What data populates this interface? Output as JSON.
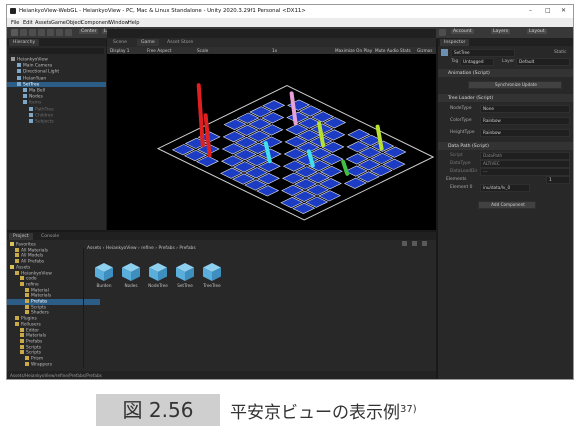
{
  "window": {
    "title": "HeiankyoView-WebGL - HeiankyoView - PC, Mac & Linux Standalone - Unity 2020.3.29f1 Personal <DX11>",
    "menu": [
      "File",
      "Edit",
      "Assets",
      "GameObject",
      "Component",
      "Window",
      "Help"
    ]
  },
  "toolbar": {
    "center_label": "Center",
    "local_label": "Local",
    "account_label": "Account",
    "layers_label": "Layers",
    "layout_label": "Layout"
  },
  "hierarchy": {
    "tab": "Hierarchy",
    "items": [
      {
        "label": "HeiankyoView",
        "depth": 0
      },
      {
        "label": "Main Camera",
        "depth": 1
      },
      {
        "label": "Directional Light",
        "depth": 1
      },
      {
        "label": "HeianYuan",
        "depth": 1
      },
      {
        "label": "SetTree",
        "depth": 1,
        "selected": true
      },
      {
        "label": "Ma Bell",
        "depth": 2
      },
      {
        "label": "Nodes",
        "depth": 2
      },
      {
        "label": "Items",
        "depth": 2,
        "faded": true
      },
      {
        "label": "PathTree",
        "depth": 3,
        "faded": true
      },
      {
        "label": "Children",
        "depth": 3,
        "faded": true
      },
      {
        "label": "Subjects",
        "depth": 3,
        "faded": true
      }
    ]
  },
  "scene": {
    "tabs": [
      "Scene",
      "Game",
      "Asset Store"
    ],
    "display": "Display 1",
    "aspect": "Free Aspect",
    "scale_label": "Scale",
    "scale_value": "1x",
    "options": [
      "Maximize On Play",
      "Mute Audio",
      "Stats",
      "Gizmos"
    ]
  },
  "inspector": {
    "tab": "Inspector",
    "object_name": "SetTree",
    "static_label": "Static",
    "tag_label": "Tag",
    "tag_value": "Untagged",
    "layer_label": "Layer",
    "layer_value": "Default",
    "sections": [
      {
        "title": "Animation (Script)"
      },
      {
        "title": "Tree Loader (Script)"
      },
      {
        "title": "Data Path (Script)"
      }
    ],
    "animation_button": "Synchronize Update",
    "tree_fields": [
      {
        "label": "NodeType",
        "value": "None"
      },
      {
        "label": "ColorType",
        "value": "Rainbow"
      },
      {
        "label": "HeightType",
        "value": "Rainbow"
      }
    ],
    "data_fields": [
      {
        "label": "Script",
        "value": "DataPath"
      },
      {
        "label": "DataType",
        "value": "ALTIVEC"
      },
      {
        "label": "DataLoadDir",
        "value": "---"
      }
    ],
    "elements_label": "Elements",
    "elements_value": "1",
    "element_label": "Element 0",
    "element_value": "inu/data/lv_0",
    "add_component": "Add Component"
  },
  "project": {
    "tabs": [
      "Project",
      "Console"
    ],
    "breadcrumb": [
      "Assets",
      "HeiankyoView",
      "refine",
      "Prefabs",
      "Prefabs"
    ],
    "tree": [
      {
        "label": "Favorites",
        "depth": 0
      },
      {
        "label": "All Materials",
        "depth": 1
      },
      {
        "label": "All Models",
        "depth": 1
      },
      {
        "label": "All Prefabs",
        "depth": 1
      },
      {
        "label": "Assets",
        "depth": 0
      },
      {
        "label": "HeiankyoView",
        "depth": 1
      },
      {
        "label": "code",
        "depth": 2
      },
      {
        "label": "refine",
        "depth": 2
      },
      {
        "label": "Material",
        "depth": 3
      },
      {
        "label": "Materials",
        "depth": 3
      },
      {
        "label": "Prefabs",
        "depth": 3,
        "selected": true
      },
      {
        "label": "Scripts",
        "depth": 3
      },
      {
        "label": "Shaders",
        "depth": 3
      },
      {
        "label": "Plugins",
        "depth": 1
      },
      {
        "label": "Rollusers",
        "depth": 1
      },
      {
        "label": "Editor",
        "depth": 2
      },
      {
        "label": "Materials",
        "depth": 2
      },
      {
        "label": "Prefabs",
        "depth": 2
      },
      {
        "label": "Scripts",
        "depth": 2
      },
      {
        "label": "Scripts",
        "depth": 2
      },
      {
        "label": "Prism",
        "depth": 3
      },
      {
        "label": "Wrappers",
        "depth": 3
      }
    ],
    "assets": [
      "Burden",
      "Nodes",
      "NodeTree",
      "SetTree",
      "TreeTree"
    ],
    "status_path": "Assets/HeiankyoView/refine/Prefabs/Prefabs"
  },
  "caption": {
    "label": "図 2.56",
    "text": "平安京ビューの表示例",
    "ref": "37)"
  },
  "colors": {
    "accent_play": "#3a79d4",
    "selection": "#2c5d87",
    "cube_icon": "#5aaedb",
    "tile": "#1c3cc4"
  }
}
